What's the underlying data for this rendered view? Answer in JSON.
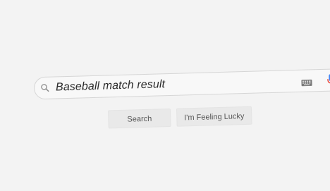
{
  "search": {
    "query": "Baseball match result"
  },
  "buttons": {
    "search_label": "Search",
    "lucky_label": "I'm Feeling Lucky"
  },
  "icons": {
    "search": "search-icon",
    "keyboard": "keyboard-icon",
    "microphone": "microphone-icon"
  },
  "colors": {
    "background": "#f3f3f3",
    "mic_blue": "#4285f4",
    "mic_red": "#ea4335"
  }
}
